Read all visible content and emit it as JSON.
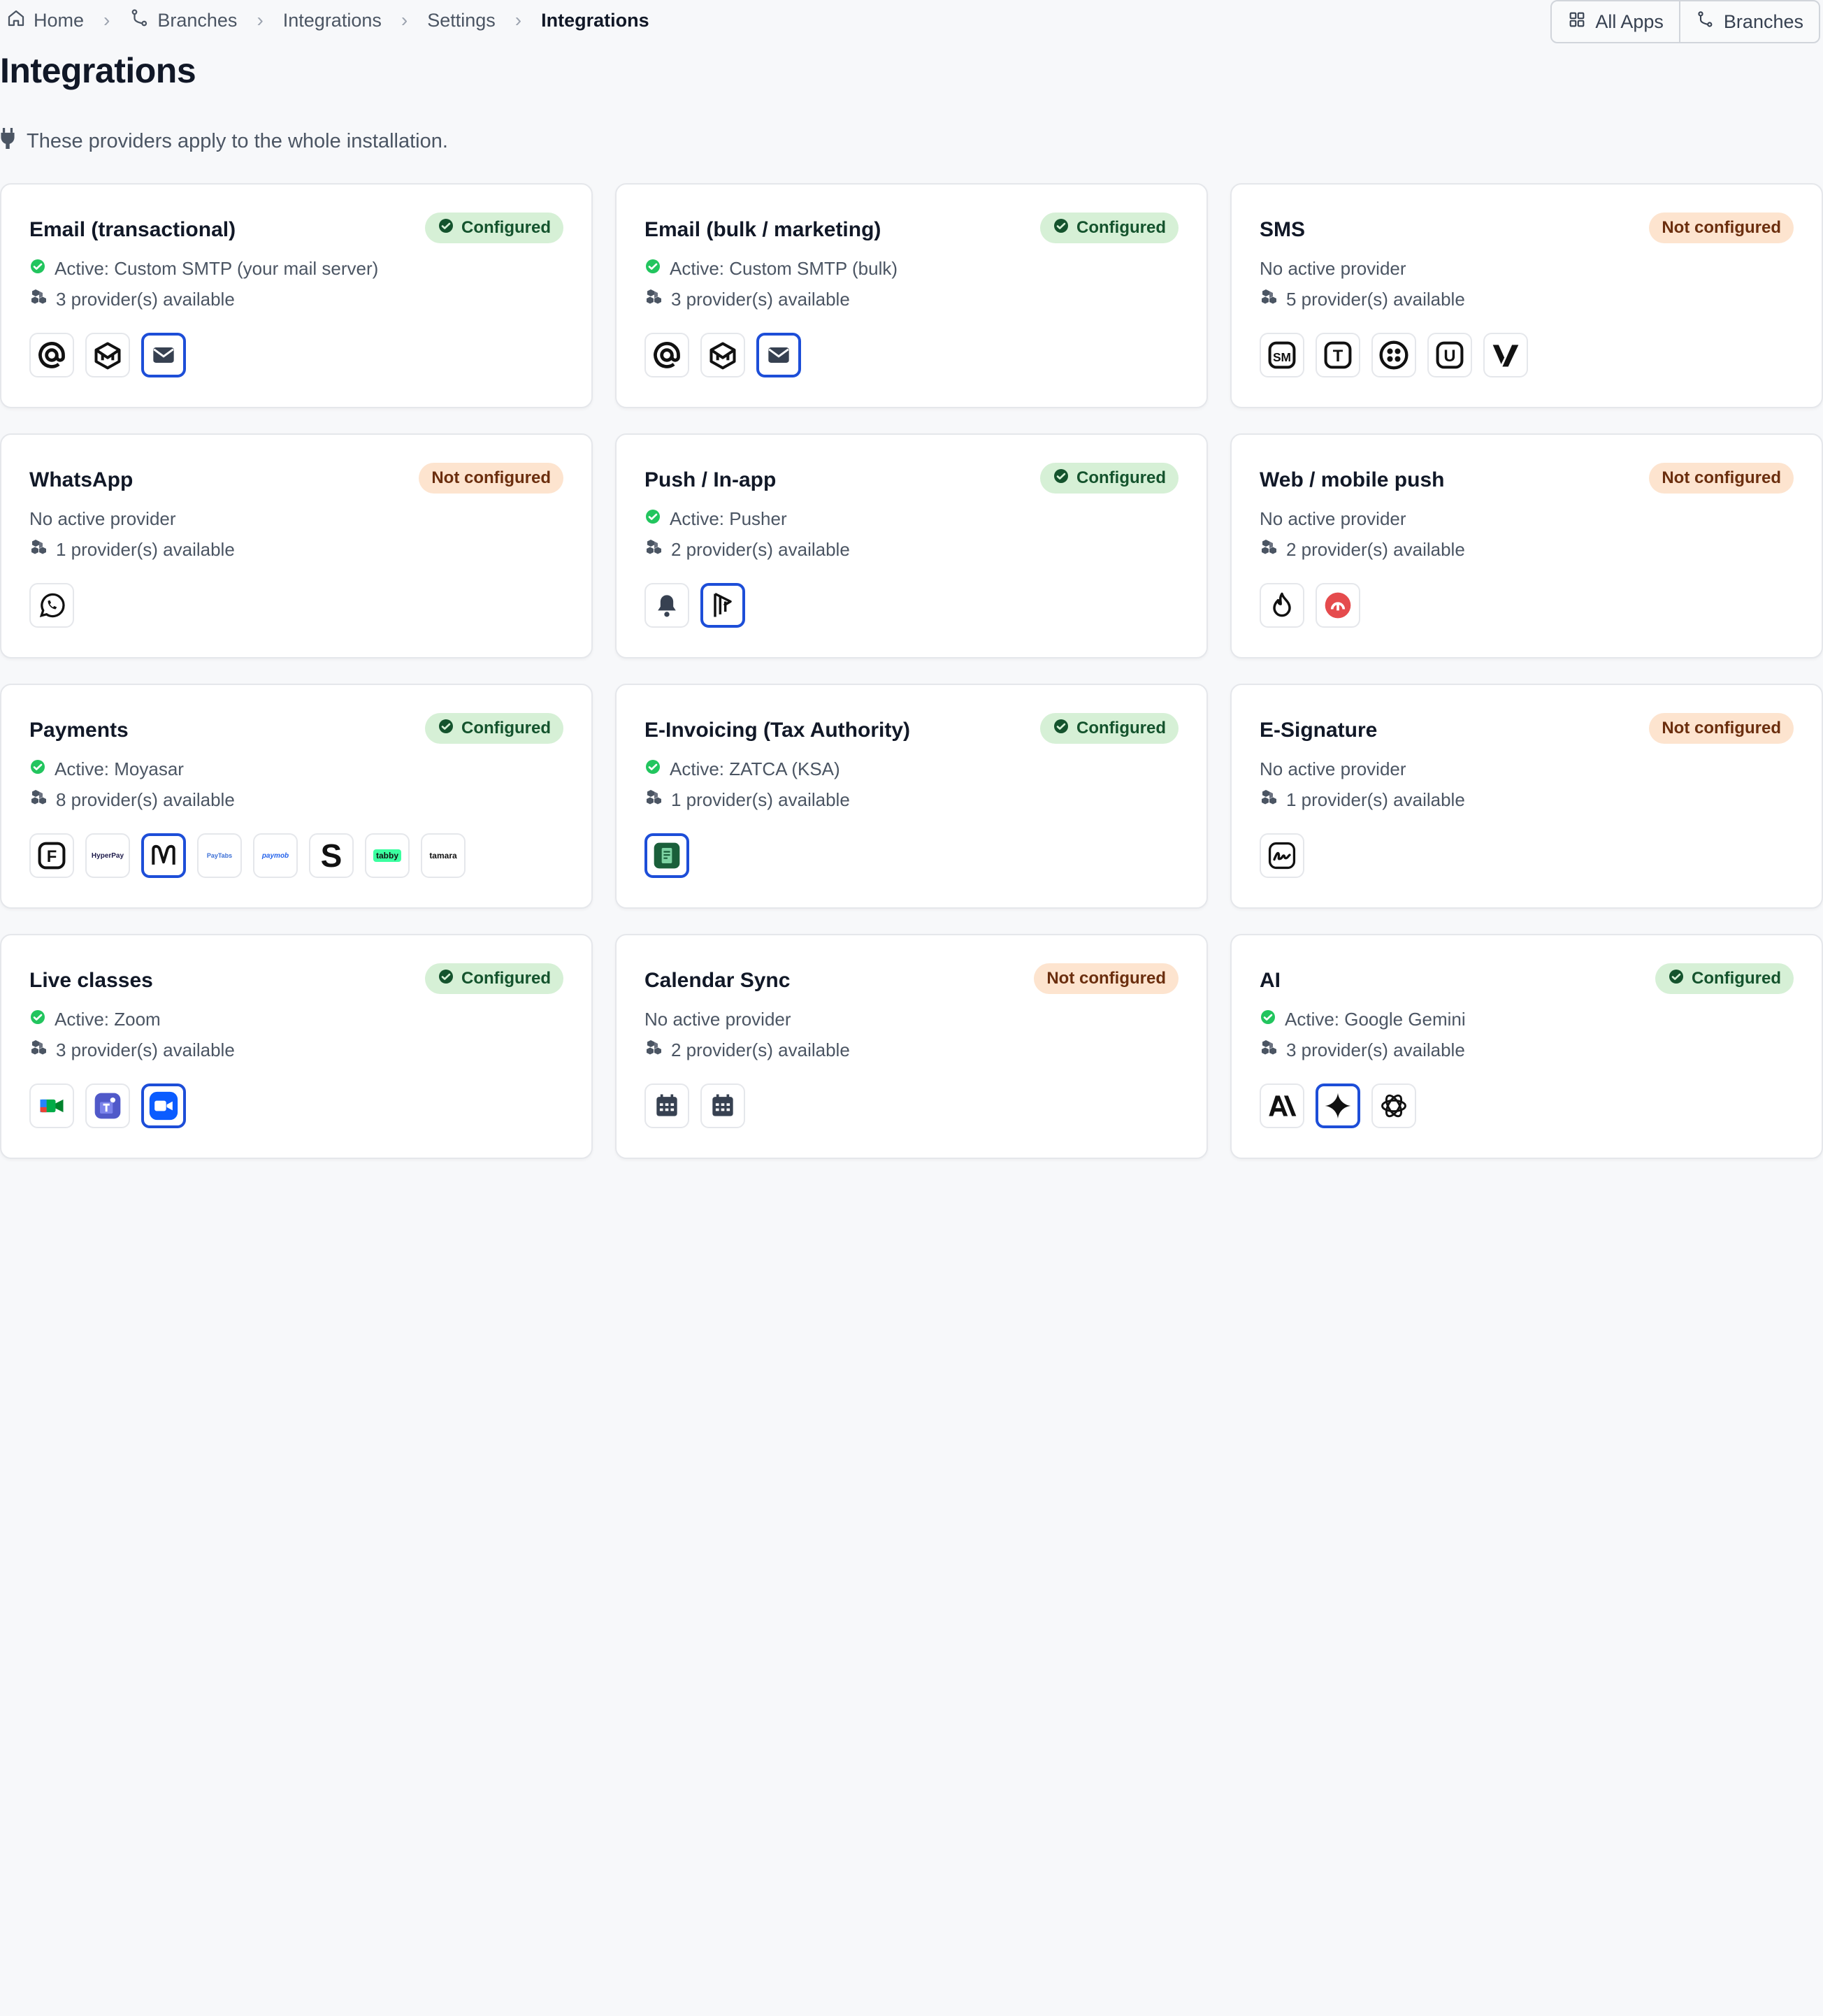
{
  "breadcrumb": {
    "items": [
      {
        "label": "Home",
        "icon": "home-icon"
      },
      {
        "label": "Branches",
        "icon": "branch-icon"
      },
      {
        "label": "Integrations"
      },
      {
        "label": "Settings"
      },
      {
        "label": "Integrations",
        "current": true
      }
    ],
    "separator": "›"
  },
  "top_actions": {
    "all_apps": "All Apps",
    "branches": "Branches"
  },
  "page": {
    "title": "Integrations",
    "subtitle": "These providers apply to the whole installation."
  },
  "colors": {
    "active_border": "#1d4ed8",
    "configured_bg": "#d6f0d6",
    "configured_text": "#14532d",
    "not_configured_bg": "#fde4cf",
    "not_configured_text": "#6b2e0e",
    "check_green": "#22c55e"
  },
  "cards": [
    {
      "title": "Email (transactional)",
      "badge": "Configured",
      "configured": true,
      "status": "Active: Custom SMTP (your mail server)",
      "count": "3 provider(s) available",
      "providers": [
        {
          "icon": "at-sign-icon"
        },
        {
          "icon": "mailjet-icon"
        },
        {
          "icon": "envelope-icon",
          "active": true
        }
      ]
    },
    {
      "title": "Email (bulk / marketing)",
      "badge": "Configured",
      "configured": true,
      "status": "Active: Custom SMTP (bulk)",
      "count": "3 provider(s) available",
      "providers": [
        {
          "icon": "at-sign-icon"
        },
        {
          "icon": "mailjet-icon"
        },
        {
          "icon": "envelope-icon",
          "active": true
        }
      ]
    },
    {
      "title": "SMS",
      "badge": "Not configured",
      "configured": false,
      "status": "No active provider",
      "count": "5 provider(s) available",
      "providers": [
        {
          "icon": "sm-icon",
          "text": "SM"
        },
        {
          "icon": "t-icon",
          "text": "T"
        },
        {
          "icon": "twilio-icon"
        },
        {
          "icon": "u-icon",
          "text": "U"
        },
        {
          "icon": "vonage-icon"
        }
      ]
    },
    {
      "title": "WhatsApp",
      "badge": "Not configured",
      "configured": false,
      "status": "No active provider",
      "count": "1 provider(s) available",
      "providers": [
        {
          "icon": "whatsapp-icon"
        }
      ]
    },
    {
      "title": "Push / In-app",
      "badge": "Configured",
      "configured": true,
      "status": "Active: Pusher",
      "count": "2 provider(s) available",
      "providers": [
        {
          "icon": "bell-icon"
        },
        {
          "icon": "pusher-icon",
          "active": true
        }
      ]
    },
    {
      "title": "Web / mobile push",
      "badge": "Not configured",
      "configured": false,
      "status": "No active provider",
      "count": "2 provider(s) available",
      "providers": [
        {
          "icon": "flame-icon"
        },
        {
          "icon": "onesignal-icon"
        }
      ]
    },
    {
      "title": "Payments",
      "badge": "Configured",
      "configured": true,
      "status": "Active: Moyasar",
      "count": "8 provider(s) available",
      "providers": [
        {
          "icon": "f-icon",
          "text": "F"
        },
        {
          "icon": "hyperpay-logo",
          "text": "HyperPay"
        },
        {
          "icon": "moyasar-icon",
          "active": true
        },
        {
          "icon": "paytabs-logo",
          "text": "PayTabs"
        },
        {
          "icon": "paymob-logo",
          "text": "paymob"
        },
        {
          "icon": "stripe-icon",
          "text": "S"
        },
        {
          "icon": "tabby-logo",
          "text": "tabby"
        },
        {
          "icon": "tamara-logo",
          "text": "tamara"
        }
      ]
    },
    {
      "title": "E-Invoicing (Tax Authority)",
      "badge": "Configured",
      "configured": true,
      "status": "Active: ZATCA (KSA)",
      "count": "1 provider(s) available",
      "providers": [
        {
          "icon": "zatca-icon",
          "active": true
        }
      ]
    },
    {
      "title": "E-Signature",
      "badge": "Not configured",
      "configured": false,
      "status": "No active provider",
      "count": "1 provider(s) available",
      "providers": [
        {
          "icon": "signature-icon"
        }
      ]
    },
    {
      "title": "Live classes",
      "badge": "Configured",
      "configured": true,
      "status": "Active: Zoom",
      "count": "3 provider(s) available",
      "providers": [
        {
          "icon": "google-meet-icon"
        },
        {
          "icon": "ms-teams-icon"
        },
        {
          "icon": "zoom-icon",
          "active": true
        }
      ]
    },
    {
      "title": "Calendar Sync",
      "badge": "Not configured",
      "configured": false,
      "status": "No active provider",
      "count": "2 provider(s) available",
      "providers": [
        {
          "icon": "calendar-icon"
        },
        {
          "icon": "calendar-icon"
        }
      ]
    },
    {
      "title": "AI",
      "badge": "Configured",
      "configured": true,
      "status": "Active: Google Gemini",
      "count": "3 provider(s) available",
      "providers": [
        {
          "icon": "anthropic-icon"
        },
        {
          "icon": "gemini-icon",
          "active": true
        },
        {
          "icon": "openai-icon"
        }
      ]
    }
  ]
}
